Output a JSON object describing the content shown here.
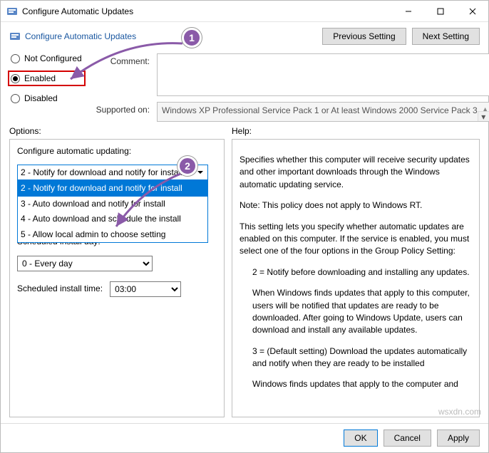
{
  "titlebar": {
    "title": "Configure Automatic Updates"
  },
  "header": {
    "page_title": "Configure Automatic Updates",
    "prev": "Previous Setting",
    "next": "Next Setting"
  },
  "radios": {
    "not_configured": "Not Configured",
    "enabled": "Enabled",
    "disabled": "Disabled"
  },
  "labels": {
    "comment": "Comment:",
    "supported": "Supported on:",
    "options": "Options:",
    "help": "Help:"
  },
  "supported_on": "Windows XP Professional Service Pack 1 or At least Windows 2000 Service Pack 3",
  "options": {
    "config_label": "Configure automatic updating:",
    "selected": "2 - Notify for download and notify for install",
    "items": {
      "o2": "2 - Notify for download and notify for install",
      "o3": "3 - Auto download and notify for install",
      "o4": "4 - Auto download and schedule the install",
      "o5": "5 - Allow local admin to choose setting"
    },
    "day_label": "Scheduled install day:",
    "day_value": "0 - Every day",
    "time_label": "Scheduled install time:",
    "time_value": "03:00"
  },
  "help": {
    "p1": "Specifies whether this computer will receive security updates and other important downloads through the Windows automatic updating service.",
    "p2": "Note: This policy does not apply to Windows RT.",
    "p3": "This setting lets you specify whether automatic updates are enabled on this computer. If the service is enabled, you must select one of the four options in the Group Policy Setting:",
    "p4": "2 = Notify before downloading and installing any updates.",
    "p5": "When Windows finds updates that apply to this computer, users will be notified that updates are ready to be downloaded. After going to Windows Update, users can download and install any available updates.",
    "p6": "3 = (Default setting) Download the updates automatically and notify when they are ready to be installed",
    "p7": "Windows finds updates that apply to the computer and"
  },
  "footer": {
    "ok": "OK",
    "cancel": "Cancel",
    "apply": "Apply"
  },
  "callouts": {
    "c1": "1",
    "c2": "2"
  },
  "watermark": "wsxdn.com"
}
